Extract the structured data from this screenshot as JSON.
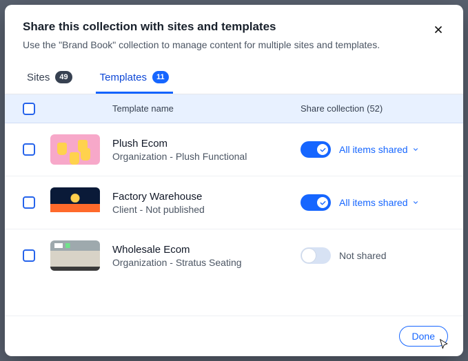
{
  "header": {
    "title": "Share this collection with sites and templates",
    "subtitle": "Use the \"Brand Book\" collection to manage content for multiple sites and templates."
  },
  "tabs": {
    "sites": {
      "label": "Sites",
      "count": "49"
    },
    "templates": {
      "label": "Templates",
      "count": "11"
    }
  },
  "columns": {
    "name": "Template name",
    "share": "Share collection (52)"
  },
  "share_labels": {
    "on": "All items shared",
    "off": "Not shared"
  },
  "rows": [
    {
      "name": "Plush Ecom",
      "meta": "Organization - Plush Functional",
      "shared": true,
      "thumb": "th-plush"
    },
    {
      "name": "Factory Warehouse",
      "meta": "Client - Not published",
      "shared": true,
      "thumb": "th-factory"
    },
    {
      "name": "Wholesale Ecom",
      "meta": "Organization - Stratus Seating",
      "shared": false,
      "thumb": "th-wholesale"
    }
  ],
  "footer": {
    "done": "Done"
  }
}
